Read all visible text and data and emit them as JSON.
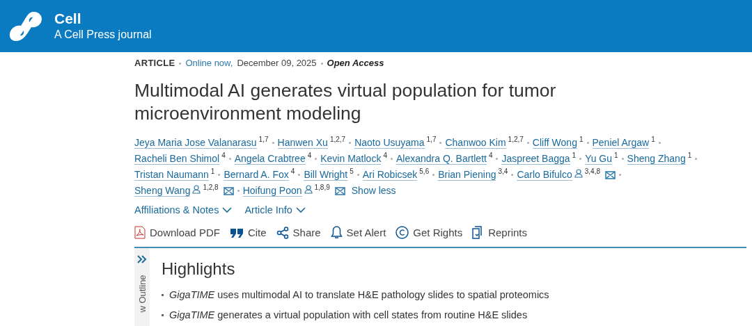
{
  "header": {
    "journal": "Cell",
    "subtitle": "A Cell Press journal"
  },
  "meta": {
    "type": "ARTICLE",
    "online": "Online now,",
    "date": "December 09, 2025",
    "access": "Open Access"
  },
  "title": "Multimodal AI generates virtual population for tumor microenvironment modeling",
  "author_lines": [
    [
      {
        "name": "Jeya Maria Jose Valanarasu",
        "affil": "1,7",
        "corresponding": false
      },
      {
        "name": "Hanwen Xu",
        "affil": "1,2,7",
        "corresponding": false
      },
      {
        "name": "Naoto Usuyama",
        "affil": "1,7",
        "corresponding": false
      },
      {
        "name": "Chanwoo Kim",
        "affil": "1,2,7",
        "corresponding": false
      },
      {
        "name": "Cliff Wong",
        "affil": "1",
        "corresponding": false
      },
      {
        "name": "Peniel Argaw",
        "affil": "1",
        "corresponding": false
      }
    ],
    [
      {
        "name": "Racheli Ben Shimol",
        "affil": "4",
        "corresponding": false
      },
      {
        "name": "Angela Crabtree",
        "affil": "4",
        "corresponding": false
      },
      {
        "name": "Kevin Matlock",
        "affil": "4",
        "corresponding": false
      },
      {
        "name": "Alexandra Q. Bartlett",
        "affil": "4",
        "corresponding": false
      },
      {
        "name": "Jaspreet Bagga",
        "affil": "1",
        "corresponding": false
      },
      {
        "name": "Yu Gu",
        "affil": "1",
        "corresponding": false
      },
      {
        "name": "Sheng Zhang",
        "affil": "1",
        "corresponding": false
      }
    ],
    [
      {
        "name": "Tristan Naumann",
        "affil": "1",
        "corresponding": false
      },
      {
        "name": "Bernard A. Fox",
        "affil": "4",
        "corresponding": false
      },
      {
        "name": "Bill Wright",
        "affil": "5",
        "corresponding": false
      },
      {
        "name": "Ari Robicsek",
        "affil": "5,6",
        "corresponding": false
      },
      {
        "name": "Brian Piening",
        "affil": "3,4",
        "corresponding": false
      },
      {
        "name": "Carlo Bifulco",
        "affil": "3,4,8",
        "corresponding": true
      }
    ],
    [
      {
        "name": "Sheng Wang",
        "affil": "1,2,8",
        "corresponding": true
      },
      {
        "name": "Hoifung Poon",
        "affil": "1,8,9",
        "corresponding": true
      }
    ]
  ],
  "show_less": "Show less",
  "expanders": [
    {
      "label": "Affiliations & Notes",
      "expanded": false
    },
    {
      "label": "Article Info",
      "expanded": false
    }
  ],
  "actions": [
    {
      "kind": "pdf",
      "label": "Download PDF"
    },
    {
      "kind": "cite",
      "label": "Cite"
    },
    {
      "kind": "share",
      "label": "Share"
    },
    {
      "kind": "alert",
      "label": "Set Alert"
    },
    {
      "kind": "rights",
      "label": "Get Rights"
    },
    {
      "kind": "reprints",
      "label": "Reprints"
    }
  ],
  "outline": {
    "label": "w Outline"
  },
  "highlights": {
    "heading": "Highlights",
    "items": [
      "*GigaTIME* uses multimodal AI to translate H&E pathology slides to spatial proteomics",
      "*GigaTIME* generates a virtual population with cell states from routine H&E slides"
    ]
  }
}
